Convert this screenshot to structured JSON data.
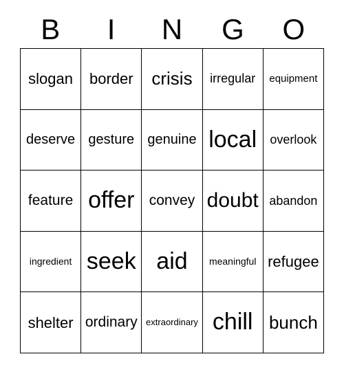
{
  "card": {
    "headers": [
      "B",
      "I",
      "N",
      "G",
      "O"
    ],
    "rows": [
      [
        {
          "word": "slogan",
          "size": 22
        },
        {
          "word": "border",
          "size": 22
        },
        {
          "word": "crisis",
          "size": 26
        },
        {
          "word": "irregular",
          "size": 18
        },
        {
          "word": "equipment",
          "size": 15
        }
      ],
      [
        {
          "word": "deserve",
          "size": 20
        },
        {
          "word": "gesture",
          "size": 20
        },
        {
          "word": "genuine",
          "size": 20
        },
        {
          "word": "local",
          "size": 34
        },
        {
          "word": "overlook",
          "size": 18
        }
      ],
      [
        {
          "word": "feature",
          "size": 21
        },
        {
          "word": "offer",
          "size": 34
        },
        {
          "word": "convey",
          "size": 21
        },
        {
          "word": "doubt",
          "size": 30
        },
        {
          "word": "abandon",
          "size": 18
        }
      ],
      [
        {
          "word": "ingredient",
          "size": 14
        },
        {
          "word": "seek",
          "size": 34
        },
        {
          "word": "aid",
          "size": 34
        },
        {
          "word": "meaningful",
          "size": 14
        },
        {
          "word": "refugee",
          "size": 22
        }
      ],
      [
        {
          "word": "shelter",
          "size": 22
        },
        {
          "word": "ordinary",
          "size": 21
        },
        {
          "word": "extraordinary",
          "size": 13
        },
        {
          "word": "chill",
          "size": 34
        },
        {
          "word": "bunch",
          "size": 26
        }
      ]
    ]
  },
  "colors": {
    "background": "#ffffff",
    "text": "#000000",
    "border": "#000000"
  }
}
